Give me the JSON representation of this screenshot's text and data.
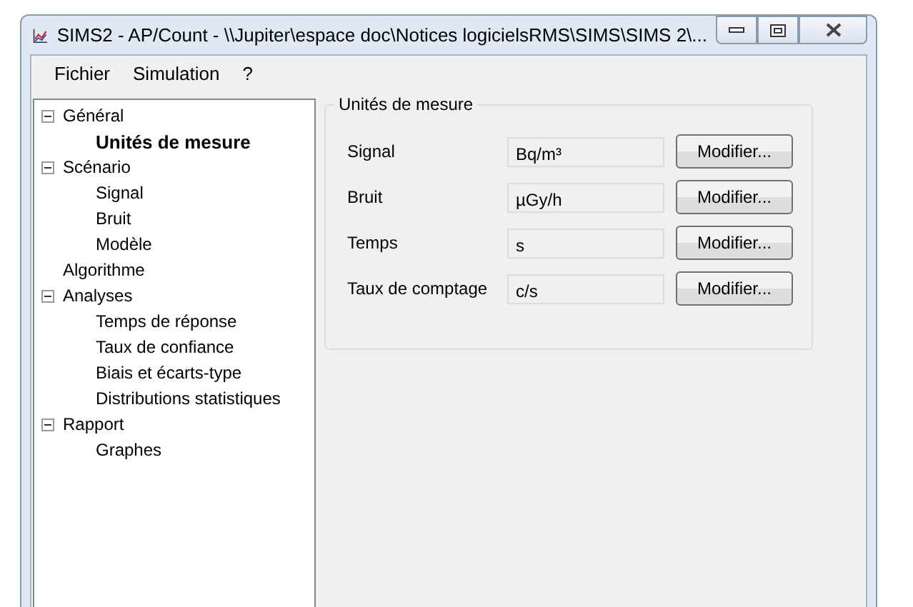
{
  "window": {
    "title": "SIMS2 - AP/Count - \\\\Jupiter\\espace doc\\Notices logicielsRMS\\SIMS\\SIMS 2\\..."
  },
  "menu": [
    "Fichier",
    "Simulation",
    "?"
  ],
  "tree": [
    {
      "label": "Général",
      "expanded": true,
      "selected": false,
      "children": [
        {
          "label": "Unités de mesure",
          "selected": true
        }
      ]
    },
    {
      "label": "Scénario",
      "expanded": true,
      "selected": false,
      "children": [
        {
          "label": "Signal",
          "selected": false
        },
        {
          "label": "Bruit",
          "selected": false
        },
        {
          "label": "Modèle",
          "selected": false
        }
      ]
    },
    {
      "label": "Algorithme",
      "selected": false
    },
    {
      "label": "Analyses",
      "expanded": true,
      "selected": false,
      "children": [
        {
          "label": "Temps de réponse",
          "selected": false
        },
        {
          "label": "Taux de confiance",
          "selected": false
        },
        {
          "label": "Biais et écarts-type",
          "selected": false
        },
        {
          "label": "Distributions statistiques",
          "selected": false
        }
      ]
    },
    {
      "label": "Rapport",
      "expanded": true,
      "selected": false,
      "children": [
        {
          "label": "Graphes",
          "selected": false
        }
      ]
    }
  ],
  "group": {
    "title": "Unités de mesure",
    "rows": [
      {
        "label": "Signal",
        "value": "Bq/m³",
        "button": "Modifier..."
      },
      {
        "label": "Bruit",
        "value": "µGy/h",
        "button": "Modifier..."
      },
      {
        "label": "Temps",
        "value": "s",
        "button": "Modifier..."
      },
      {
        "label": "Taux de comptage",
        "value": "c/s",
        "button": "Modifier..."
      }
    ]
  }
}
